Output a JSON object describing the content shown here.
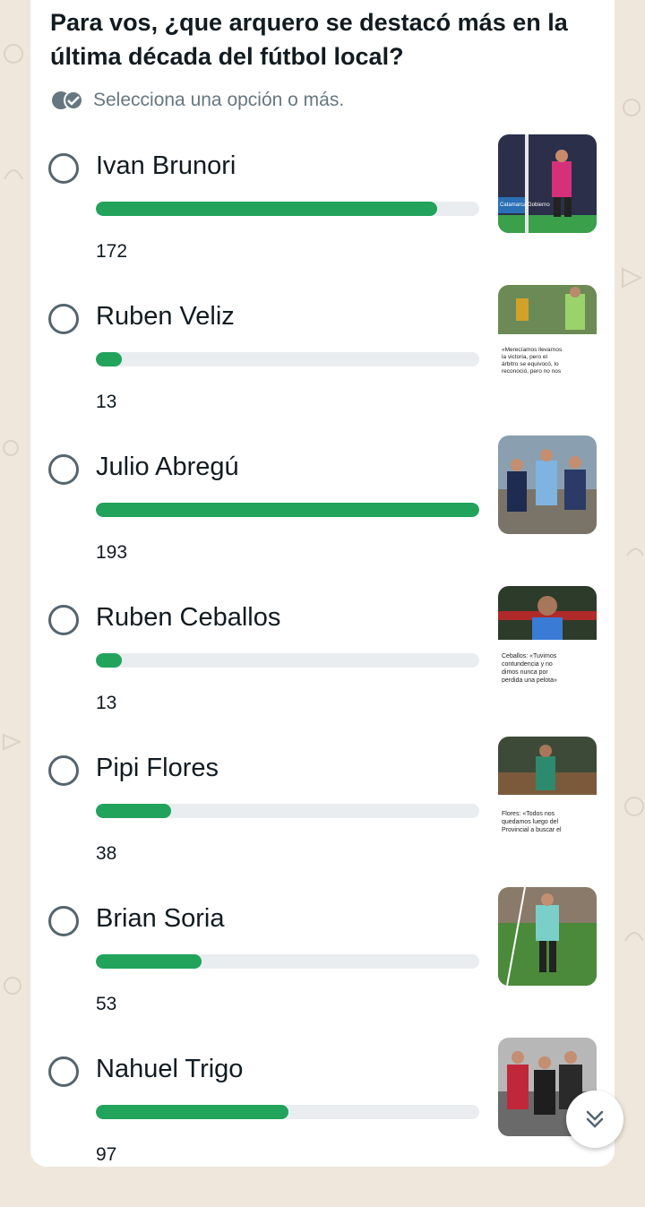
{
  "poll": {
    "question": "Para vos, ¿que arquero se destacó más en la última década del fútbol local?",
    "hint": "Selecciona una opción o más.",
    "max_votes": 193,
    "options": [
      {
        "label": "Ivan Brunori",
        "votes": 172,
        "count": "172",
        "thumb_text": "Catamarca Gobierno"
      },
      {
        "label": "Ruben Veliz",
        "votes": 13,
        "count": "13",
        "thumb_text": "«Merecíamos llevarnos la victoria, pero el árbitro se equivocó, lo reconoció, pero no nos"
      },
      {
        "label": "Julio Abregú",
        "votes": 193,
        "count": "193",
        "thumb_text": ""
      },
      {
        "label": "Ruben Ceballos",
        "votes": 13,
        "count": "13",
        "thumb_text": "Ceballos: «Tuvimos contundencia y no dimos nunca por perdida una pelota»"
      },
      {
        "label": "Pipi Flores",
        "votes": 38,
        "count": "38",
        "thumb_text": "Flores: «Todos nos quedamos luego del Provincial a buscar el"
      },
      {
        "label": "Brian Soria",
        "votes": 53,
        "count": "53",
        "thumb_text": ""
      },
      {
        "label": "Nahuel Trigo",
        "votes": 97,
        "count": "97",
        "thumb_text": ""
      }
    ]
  },
  "colors": {
    "bar": "#21a35b",
    "track": "#e9edef",
    "radio": "#54656f"
  },
  "icons": {
    "hint": "double-check-icon",
    "scroll": "chevron-double-down-icon"
  }
}
